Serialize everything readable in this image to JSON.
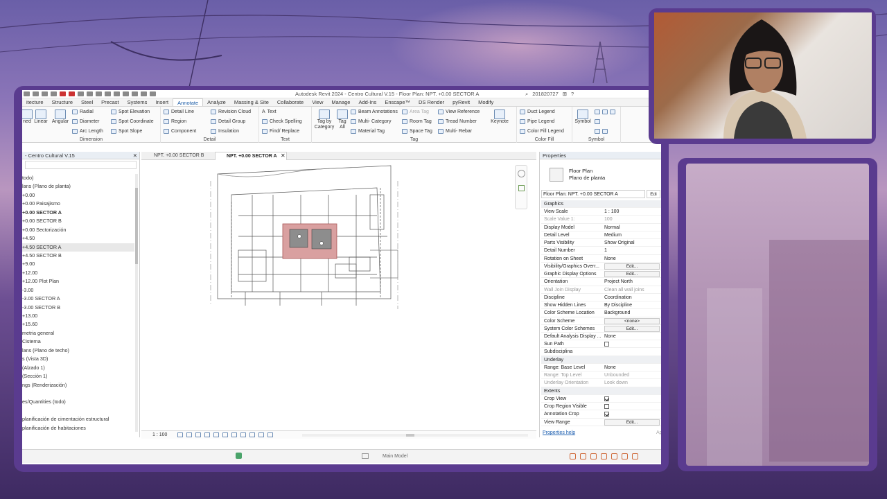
{
  "app": {
    "title": "Autodesk Revit 2024 - Centro Cultural V.15 - Floor Plan: NPT. +0.00 SECTOR A",
    "user": "201820727"
  },
  "ribbon_tabs": [
    "itecture",
    "Structure",
    "Steel",
    "Precast",
    "Systems",
    "Insert",
    "Annotate",
    "Analyze",
    "Massing & Site",
    "Collaborate",
    "View",
    "Manage",
    "Add-Ins",
    "Enscape™",
    "DS Render",
    "pyRevit",
    "Modify"
  ],
  "active_tab": "Annotate",
  "ribbon": {
    "dimension": {
      "title": "Dimension",
      "aligned": "ned",
      "linear": "Linear",
      "angular": "Angular",
      "radial": "Radial",
      "diameter": "Diameter",
      "arc_length": "Arc Length",
      "spot_elevation": "Spot Elevation",
      "spot_coordinate": "Spot Coordinate",
      "spot_slope": "Spot Slope"
    },
    "detail": {
      "title": "Detail",
      "detail_line": "Detail Line",
      "region": "Region",
      "component": "Component",
      "revision_cloud": "Revision Cloud",
      "detail_group": "Detail Group",
      "insulation": "Insulation"
    },
    "text": {
      "title": "Text",
      "text": "Text",
      "check_spelling": "Check Spelling",
      "find_replace": "Find/ Replace"
    },
    "tag": {
      "title": "Tag",
      "tag_by_category": "Tag by Category",
      "tag_all": "Tag All",
      "beam_annotations": "Beam Annotations",
      "multi_category": "Multi- Category",
      "material_tag": "Material Tag",
      "area_tag": "Area Tag",
      "room_tag": "Room Tag",
      "space_tag": "Space Tag",
      "view_reference": "View Reference",
      "tread_number": "Tread Number",
      "multi_rebar": "Multi- Rebar",
      "keynote": "Keynote"
    },
    "color_fill": {
      "title": "Color Fill",
      "duct_legend": "Duct Legend",
      "pipe_legend": "Pipe Legend",
      "color_fill_legend": "Color Fill Legend"
    },
    "symbol": {
      "title": "Symbol",
      "symbol": "Symbol"
    }
  },
  "browser": {
    "title": "- Centro Cultural V.15",
    "items": [
      "todo)",
      "lans (Plano de planta)",
      "+0.00",
      "+0.00 Paisajismo",
      "+0.00 SECTOR A",
      "+0.00 SECTOR B",
      "+0.00 Sectorización",
      "+4.50",
      "+4.50 SECTOR A",
      "+4.50 SECTOR B",
      "+9.00",
      "+12.00",
      "+12.00 Plot Plan",
      "-3.00",
      "-3.00 SECTOR A",
      "-3.00 SECTOR B",
      "+13.00",
      "+15.60",
      "metria general",
      "Cisterna",
      "lans (Plano de techo)",
      "s (Vista 3D)",
      "(Alzado 1)",
      "(Sección 1)",
      "ngs (Renderización)",
      "",
      "es/Quantities (todo)",
      "",
      "planificación de cimentación estructural",
      "planificación de habitaciones"
    ],
    "selected_index": 8,
    "bold_index": 4
  },
  "view_tabs": [
    "NPT. +0.00 SECTOR B",
    "NPT. +0.00 SECTOR A"
  ],
  "view_scale": "1 : 100",
  "properties": {
    "title": "Properties",
    "type_name": "Floor Plan",
    "type_sub": "Plano de planta",
    "type_selector": "Floor Plan: NPT. +0.00 SECTOR A",
    "edit_type": "Edi",
    "rows": [
      {
        "k": "Graphics",
        "section": true
      },
      {
        "k": "View Scale",
        "v": "1 : 100"
      },
      {
        "k": "Scale Value   1:",
        "v": "100",
        "dim": true
      },
      {
        "k": "Display Model",
        "v": "Normal"
      },
      {
        "k": "Detail Level",
        "v": "Medium"
      },
      {
        "k": "Parts Visibility",
        "v": "Show Original"
      },
      {
        "k": "Detail Number",
        "v": "1"
      },
      {
        "k": "Rotation on Sheet",
        "v": "None"
      },
      {
        "k": "Visibility/Graphics Overr...",
        "v": "Edit...",
        "btn": true
      },
      {
        "k": "Graphic Display Options",
        "v": "Edit...",
        "btn": true
      },
      {
        "k": "Orientation",
        "v": "Project North"
      },
      {
        "k": "Wall Join Display",
        "v": "Clean all wall joins",
        "dim": true
      },
      {
        "k": "Discipline",
        "v": "Coordination"
      },
      {
        "k": "Show Hidden Lines",
        "v": "By Discipline"
      },
      {
        "k": "Color Scheme Location",
        "v": "Background"
      },
      {
        "k": "Color Scheme",
        "v": "<none>",
        "btn": true
      },
      {
        "k": "System Color Schemes",
        "v": "Edit...",
        "btn": true
      },
      {
        "k": "Default Analysis Display ...",
        "v": "None"
      },
      {
        "k": "Sun Path",
        "v": "",
        "check": false
      },
      {
        "k": "Subdisciplina",
        "v": ""
      },
      {
        "k": "Underlay",
        "section": true
      },
      {
        "k": "Range: Base Level",
        "v": "None"
      },
      {
        "k": "Range: Top Level",
        "v": "Unbounded",
        "dim": true
      },
      {
        "k": "Underlay Orientation",
        "v": "Look down",
        "dim": true
      },
      {
        "k": "Extents",
        "section": true
      },
      {
        "k": "Crop View",
        "v": "",
        "check": true
      },
      {
        "k": "Crop Region Visible",
        "v": "",
        "check": false
      },
      {
        "k": "Annotation Crop",
        "v": "",
        "check": true
      },
      {
        "k": "View Range",
        "v": "Edit...",
        "btn": true
      }
    ],
    "help": "Properties help",
    "apply": "Ap"
  },
  "status": {
    "model": "Main Model"
  },
  "colors": {
    "accent": "#1a5ba6",
    "frame": "#5a3b8f",
    "room_fill": "#d9a0a0"
  }
}
